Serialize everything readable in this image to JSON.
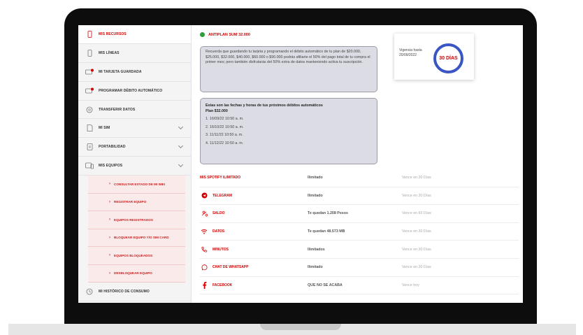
{
  "colors": {
    "brand_red": "#d00000",
    "active_green": "#2e9e3a",
    "ring_blue": "#3a56c4",
    "sidebar_bg": "#f4f4f4",
    "submenu_bg": "#fbeaea"
  },
  "sidebar": {
    "items": [
      {
        "label": "MIS RECURSOS",
        "icon": "phone-icon",
        "active": true
      },
      {
        "label": "MIS LÍNEAS",
        "icon": "sim-icon"
      },
      {
        "label": "MI TARJETA GUARDADA",
        "icon": "card-icon"
      },
      {
        "label": "PROGRAMAR DÉBITO AUTOMÁTICO",
        "icon": "calendar-card-icon"
      },
      {
        "label": "TRANSFERIR DATOS",
        "icon": "transfer-icon"
      },
      {
        "label": "MI SIM",
        "icon": "sim-card-icon",
        "expandable": true
      },
      {
        "label": "PORTABILIDAD",
        "icon": "portability-icon",
        "expandable": true
      },
      {
        "label": "MIS EQUIPOS",
        "icon": "devices-icon",
        "expandable": true
      }
    ],
    "subitems": [
      "CONSULTAR ESTADO DE MI IMEI",
      "REGISTRAR EQUIPO",
      "EQUIPOS REGISTRADOS",
      "BLOQUEAR EQUIPO Y/O SIM CARD",
      "EQUIPOS BLOQUEADOS",
      "DESBLOQUEAR EQUIPO"
    ],
    "footer_item": {
      "label": "MI HISTÓRICO DE CONSUMO",
      "icon": "history-icon"
    }
  },
  "plan": {
    "title": "ANTIPLAN SUM 32.000",
    "info_text": "Recuerda que guardando tu tarjeta y programando el débito automático de tu plan de $20.000, $25.000, $32.000, $40.000, $60.000 o $90.000 podrás afiliarte el 50% del pago total de tu compra el primer mes; pero también disfrutarás del 50% extra de datos manteniendo activa tu suscripción.",
    "schedule_title": "Estas son las fechas y horas de tus próximos débitos automáticos",
    "schedule_plan": "Plan $32.000",
    "schedule": [
      "1. 16/09/22 10:50 a. m.",
      "2. 16/10/22 10:50 a. m.",
      "3. 11/11/22 10:50 a. m.",
      "4. 11/12/22 10:50 a. m."
    ]
  },
  "validity": {
    "label": "Vigencia hasta 20/09/2022",
    "days": "30 DÍAS"
  },
  "resources": [
    {
      "name": "MIS SPOTIFY ILIMITADO",
      "icon": "",
      "status": "Ilimitado",
      "expires": "Vence en 30 Días"
    },
    {
      "name": "TELEGRAM",
      "icon": "telegram-icon",
      "status": "Ilimitado",
      "expires": "Vence en 30 Días"
    },
    {
      "name": "SALDO",
      "icon": "balance-icon",
      "status": "Te quedan 1.208 Pesos",
      "expires": "Vence en 60 Días"
    },
    {
      "name": "DATOS",
      "icon": "wifi-icon",
      "status": "Te quedan 48.573 MB",
      "expires": "Vence en 30 Días"
    },
    {
      "name": "MINUTOS",
      "icon": "call-icon",
      "status": "Ilimitados",
      "expires": "Vence en 30 Días"
    },
    {
      "name": "CHAT DE WHATSAPP",
      "icon": "whatsapp-icon",
      "status": "Ilimitado",
      "expires": "Vence en 30 Días"
    },
    {
      "name": "FACEBOOK",
      "icon": "facebook-icon",
      "status": "QUE NO SE ACABA",
      "expires": "Vence hoy"
    }
  ]
}
